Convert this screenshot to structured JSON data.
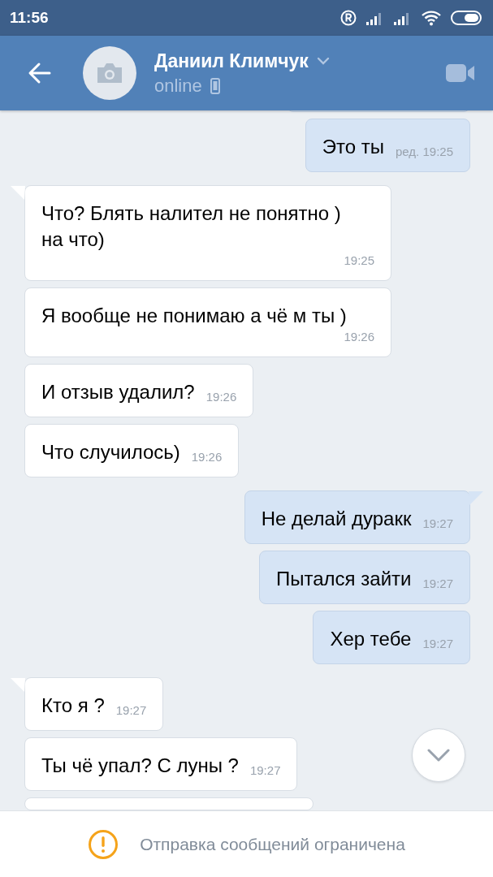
{
  "status_bar": {
    "time": "11:56"
  },
  "header": {
    "name": "Даниил Климчук",
    "status": "online"
  },
  "messages": [
    {
      "outgoing": true,
      "kind": "partial"
    },
    {
      "outgoing": true,
      "kind": "message",
      "tail": false,
      "text": "Это ты",
      "time": "ред. 19:25"
    },
    {
      "outgoing": false,
      "kind": "message",
      "tail": true,
      "text": "Что? Блять налител не понятно ) на что)",
      "time": "19:25"
    },
    {
      "outgoing": false,
      "kind": "message",
      "tail": false,
      "text": "Я вообще не понимаю а чё м ты )",
      "time": "19:26"
    },
    {
      "outgoing": false,
      "kind": "message",
      "tail": false,
      "text": "И отзыв удалил?",
      "time": "19:26"
    },
    {
      "outgoing": false,
      "kind": "message",
      "tail": false,
      "text": "Что случилось)",
      "time": "19:26"
    },
    {
      "outgoing": true,
      "kind": "message",
      "tail": true,
      "text": "Не делай дуракк",
      "time": "19:27"
    },
    {
      "outgoing": true,
      "kind": "message",
      "tail": false,
      "text": "Пытался зайти",
      "time": "19:27"
    },
    {
      "outgoing": true,
      "kind": "message",
      "tail": false,
      "text": "Хер тебе",
      "time": "19:27"
    },
    {
      "outgoing": false,
      "kind": "message",
      "tail": true,
      "text": "Кто я ?",
      "time": "19:27"
    },
    {
      "outgoing": false,
      "kind": "message",
      "tail": false,
      "text": "Ты чё упал? С луны ?",
      "time": "19:27"
    },
    {
      "outgoing": false,
      "kind": "partial"
    }
  ],
  "footer": {
    "notice": "Отправка сообщений ограничена"
  }
}
